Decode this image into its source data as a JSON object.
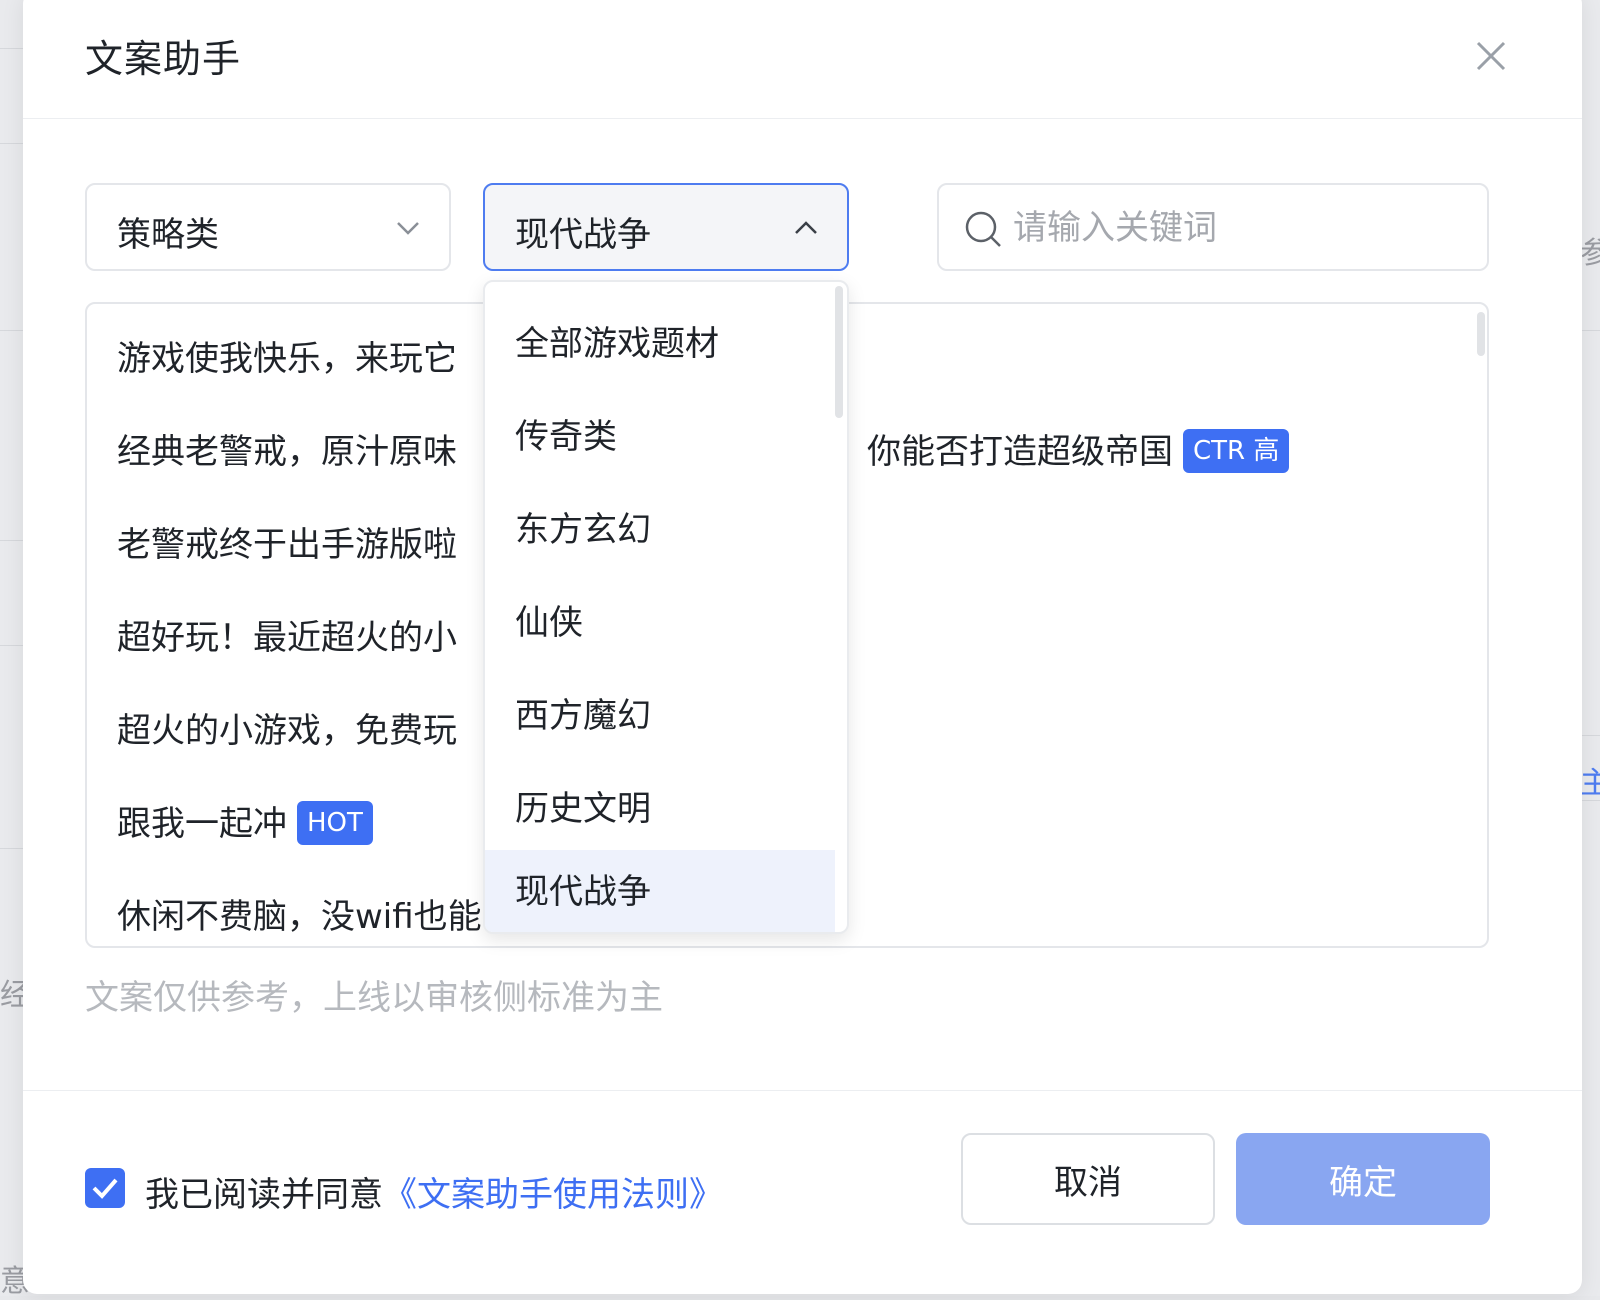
{
  "dialog": {
    "title": "文案助手",
    "close_icon": "close-icon"
  },
  "filters": {
    "category": {
      "value": "策略类",
      "icon": "chevron-down-icon"
    },
    "theme": {
      "value": "现代战争",
      "icon": "chevron-up-icon",
      "open": true
    },
    "search": {
      "placeholder": "请输入关键词",
      "value": "",
      "icon": "search-icon"
    }
  },
  "theme_dropdown": {
    "options": [
      "全部游戏题材",
      "传奇类",
      "东方玄幻",
      "仙侠",
      "西方魔幻",
      "历史文明",
      "现代战争"
    ],
    "selected_index": 6
  },
  "copy_list": {
    "items": [
      {
        "text": "游戏使我快乐，来玩它",
        "tag": ""
      },
      {
        "text": "经典老警戒，原汁原味",
        "tail": "你能否打造超级帝国",
        "tag": "CTR 高"
      },
      {
        "text": "老警戒终于出手游版啦",
        "tag": ""
      },
      {
        "text": "超好玩！最近超火的小",
        "tag": ""
      },
      {
        "text": "超火的小游戏，免费玩",
        "tag": ""
      },
      {
        "text": "跟我一起冲",
        "tag": "HOT"
      },
      {
        "text": "休闲不费脑，没wifi也能",
        "tag": ""
      }
    ]
  },
  "disclaimer": "文案仅供参考，上线以审核侧标准为主",
  "footer": {
    "agree_checked": true,
    "agree_text": "我已阅读并同意",
    "agree_link": "《文案助手使用法则》",
    "cancel_label": "取消",
    "ok_label": "确定"
  },
  "colors": {
    "accent": "#3e6ff3",
    "ok_disabled": "#89a6f1"
  },
  "background_fragments": {
    "right_top": "参",
    "right_mid": "主",
    "left_mid": "经",
    "left_bottom": "意"
  }
}
